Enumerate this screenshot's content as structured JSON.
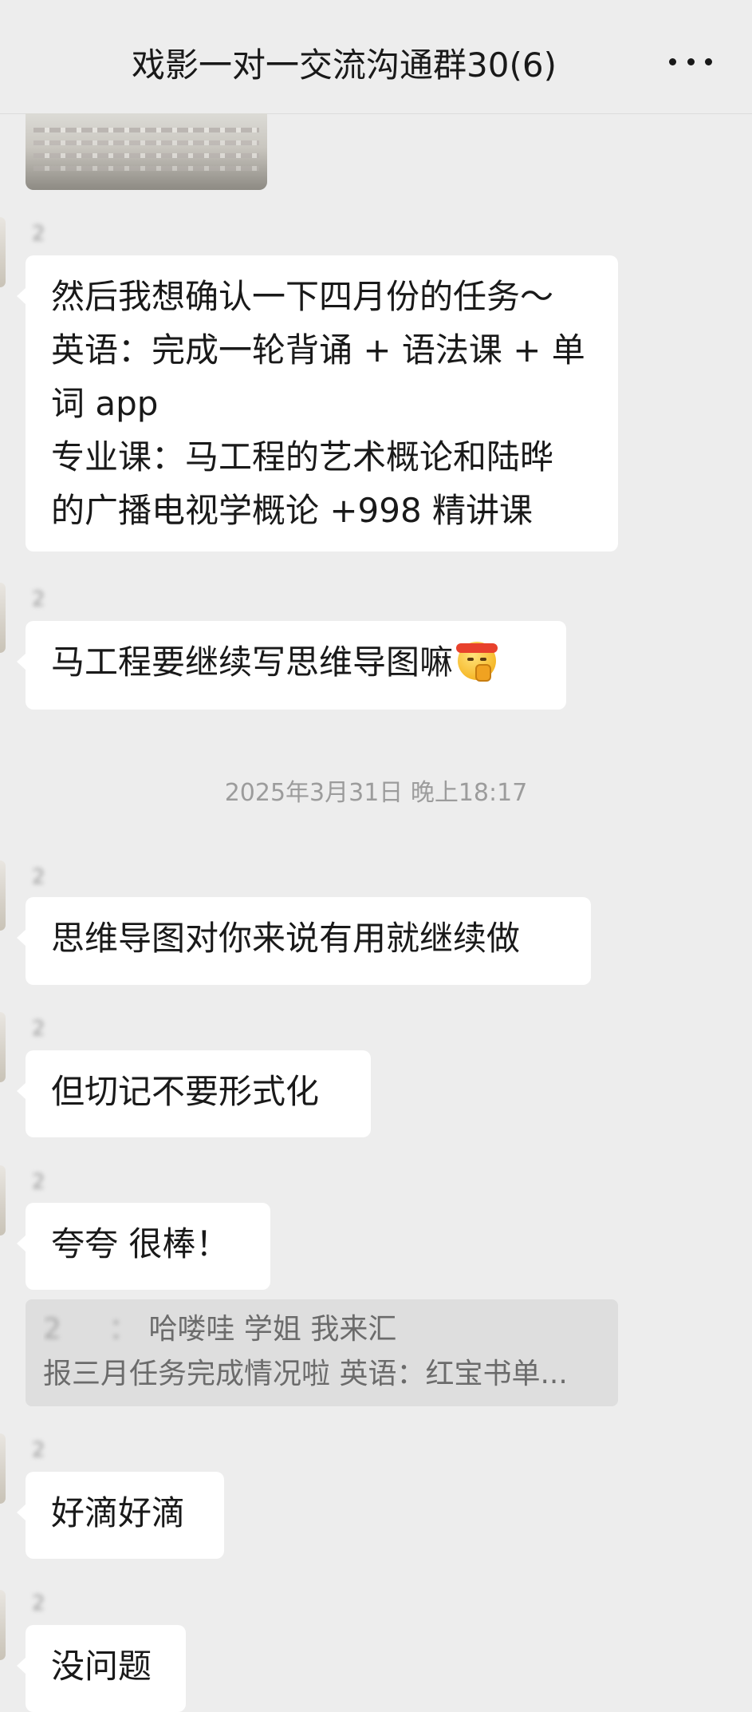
{
  "header": {
    "title": "戏影一对一交流沟通群30(6)",
    "more_icon": "more-horizontal-icon"
  },
  "messages": [
    {
      "sender": "2       ",
      "lines": [
        "然后我想确认一下四月份的任务～",
        "英语：完成一轮背诵 + 语法课 + 单",
        "词 app",
        "专业课：马工程的艺术概论和陆晔",
        "的广播电视学概论 +998 精讲课"
      ]
    },
    {
      "sender": "2       ",
      "text": "马工程要继续写思维导图嘛",
      "emoji": "saluting-face-emoji"
    },
    {
      "sender": "2         ",
      "text": "思维导图对你来说有用就继续做"
    },
    {
      "sender": "2         ",
      "text": "但切记不要形式化"
    },
    {
      "sender": "2         ",
      "text": "夸夸 很棒！",
      "quote": {
        "sender_blurred": "2         ：",
        "line1": "哈喽哇 学姐 我来汇",
        "line2": "报三月任务完成情况啦 英语：红宝书单..."
      }
    },
    {
      "sender": "2       ",
      "text": "好滴好滴"
    },
    {
      "sender": "2         ",
      "text": "没问题"
    }
  ],
  "timestamp": "2025年3月31日 晚上18:17"
}
